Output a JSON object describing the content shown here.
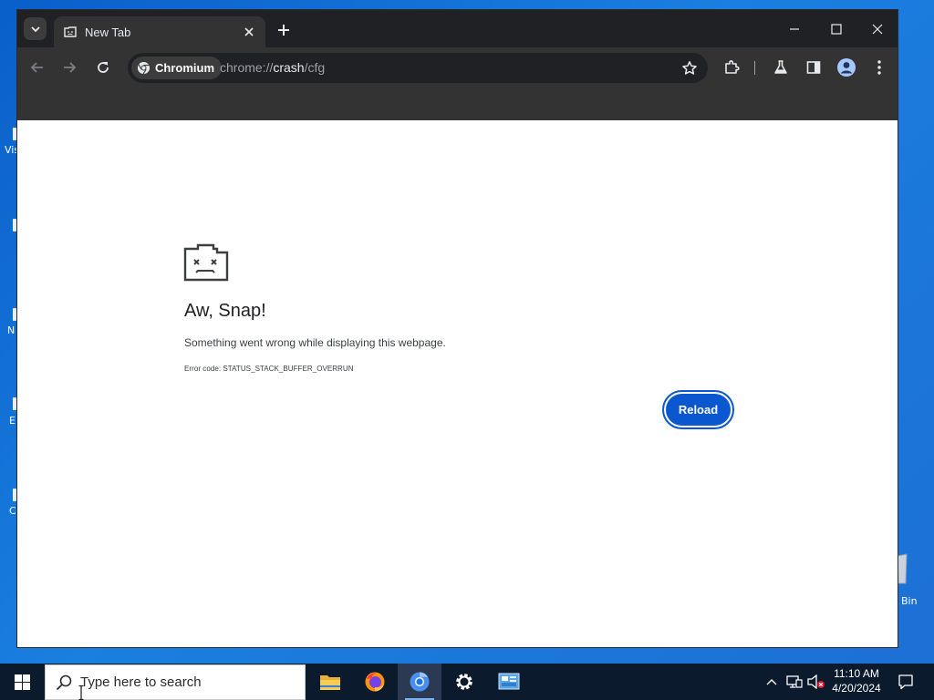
{
  "desktop": {
    "fragments": [
      "Vis",
      "N",
      "E",
      "C"
    ],
    "recycle_bin_label": "Bin"
  },
  "browser": {
    "tab": {
      "title": "New Tab"
    },
    "address_bar": {
      "chip_label": "Chromium",
      "url_scheme": "chrome://",
      "url_host": "crash",
      "url_path": "/cfg"
    }
  },
  "page": {
    "heading": "Aw, Snap!",
    "message": "Something went wrong while displaying this webpage.",
    "error_code": "Error code: STATUS_STACK_BUFFER_OVERRUN",
    "reload_label": "Reload",
    "accent_color": "#0b57d0"
  },
  "taskbar": {
    "search_placeholder": "Type here to search",
    "apps": [
      "file-explorer-icon",
      "firefox-icon",
      "chromium-icon",
      "settings-icon",
      "control-panel-icon"
    ],
    "time": "11:10 AM",
    "date": "4/20/2024"
  }
}
